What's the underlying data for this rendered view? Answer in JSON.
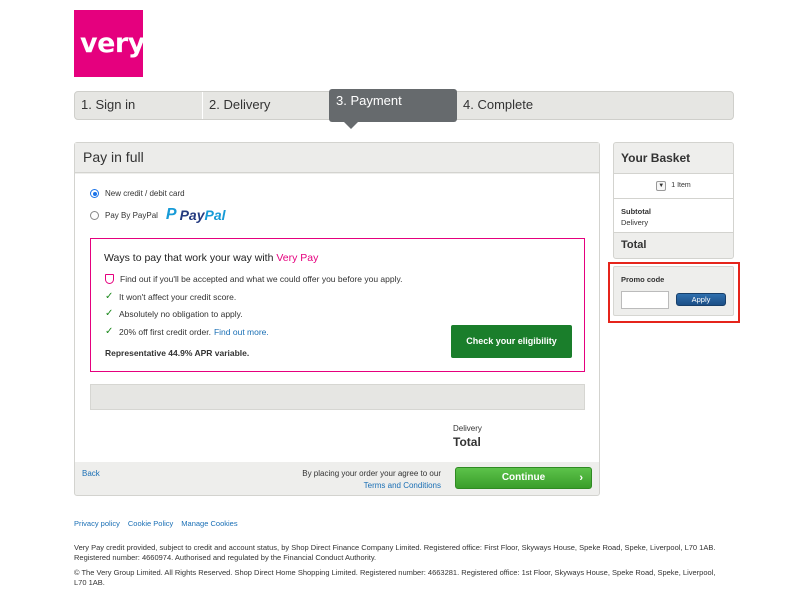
{
  "brand": {
    "logo_text": "very",
    "color": "#e5007e"
  },
  "steps": [
    {
      "label": "1. Sign in"
    },
    {
      "label": "2. Delivery"
    },
    {
      "label": "3. Payment",
      "active": true
    },
    {
      "label": "4. Complete"
    }
  ],
  "payment": {
    "title": "Pay in full",
    "option_card": "New credit / debit card",
    "option_paypal": "Pay By PayPal",
    "paypal_logo_pay": "Pay",
    "paypal_logo_pal": "Pal"
  },
  "very_pay": {
    "title_prefix": "Ways to pay that work your way with",
    "title_brand": "Very Pay",
    "line1": "Find out if you'll be accepted and what we could offer you before you apply.",
    "line2": "It won't affect your credit score.",
    "line3": "Absolutely no obligation to apply.",
    "line4": "20% off first credit order.",
    "line4_link": "Find out more.",
    "apr": "Representative 44.9% APR variable.",
    "button": "Check your eligibility"
  },
  "summary": {
    "delivery": "Delivery",
    "total": "Total"
  },
  "actions": {
    "back": "Back",
    "terms_prefix": "By placing your order your agree to our",
    "terms_link": "Terms and Conditions",
    "continue": "Continue",
    "continue_arrow": "›"
  },
  "basket": {
    "title": "Your Basket",
    "items": "1 Item",
    "subtotal": "Subtotal",
    "delivery": "Delivery",
    "total": "Total"
  },
  "promo": {
    "label": "Promo code",
    "value": "",
    "button": "Apply"
  },
  "footer": {
    "links": [
      "Privacy policy",
      "Cookie Policy",
      "Manage Cookies"
    ],
    "text1": "Very Pay credit provided, subject to credit and account status, by Shop Direct Finance Company Limited. Registered office: First Floor, Skyways House, Speke Road, Speke, Liverpool, L70 1AB. Registered number: 4660974. Authorised and regulated by the Financial Conduct Authority.",
    "text2": "© The Very Group Limited. All Rights Reserved. Shop Direct Home Shopping Limited. Registered number: 4663281. Registered office: 1st Floor, Skyways House, Speke Road, Speke, Liverpool, L70 1AB."
  }
}
